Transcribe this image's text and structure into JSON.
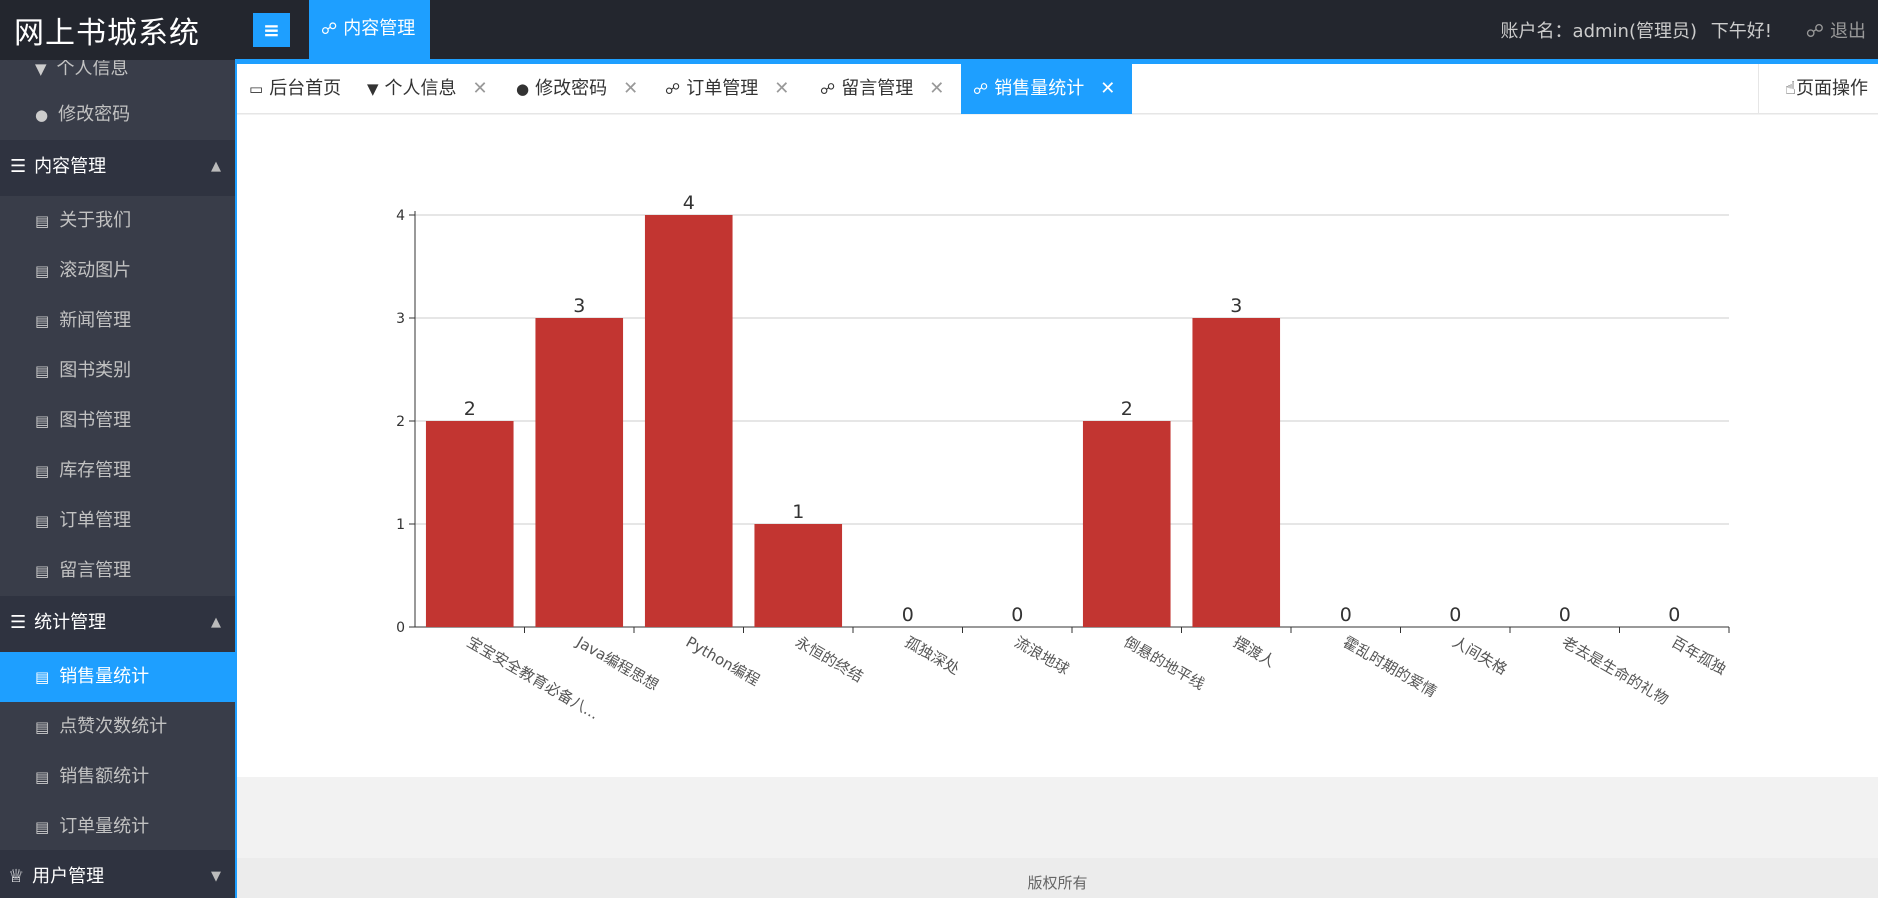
{
  "app": {
    "title": "网上书城系统",
    "menu_toggle_glyph": "≡",
    "top_tab": "内容管理",
    "user": "账户名：admin(管理员)",
    "greeting": "下午好!",
    "logout": "退出"
  },
  "sidebar": {
    "items_top": [
      "个人信息",
      "修改密码"
    ],
    "group_content": "内容管理",
    "content_items": [
      "关于我们",
      "滚动图片",
      "新闻管理",
      "图书类别",
      "图书管理",
      "库存管理",
      "订单管理",
      "留言管理"
    ],
    "group_stats": "统计管理",
    "stats_items": [
      "销售量统计",
      "点赞次数统计",
      "销售额统计",
      "订单量统计"
    ],
    "active_item": "销售量统计",
    "group_users": "用户管理"
  },
  "tabs": [
    {
      "label": "后台首页",
      "icon": "monitor-icon",
      "closable": false
    },
    {
      "label": "个人信息",
      "icon": "shirt-icon",
      "closable": true
    },
    {
      "label": "修改密码",
      "icon": "user-lock-icon",
      "closable": true
    },
    {
      "label": "订单管理",
      "icon": "hand-coins-icon",
      "closable": true
    },
    {
      "label": "留言管理",
      "icon": "hand-coins-icon",
      "closable": true
    },
    {
      "label": "销售量统计",
      "icon": "hand-coins-icon",
      "closable": true,
      "active": true
    }
  ],
  "page_ops": "页面操作",
  "footer": "版权所有",
  "colors": {
    "accent": "#1e9fff",
    "bar": "#c23531",
    "header_bg": "#23262e",
    "sidebar_bg": "#393d49"
  },
  "chart_data": {
    "type": "bar",
    "categories": [
      "宝宝安全教育必备八...",
      "Java编程思想",
      "Python编程",
      "永恒的终结",
      "孤独深处",
      "流浪地球",
      "倒悬的地平线",
      "摆渡人",
      "霍乱时期的爱情",
      "人间失格",
      "老去是生命的礼物",
      "百年孤独"
    ],
    "values": [
      2,
      3,
      4,
      1,
      0,
      0,
      2,
      3,
      0,
      0,
      0,
      0
    ],
    "ylim": [
      0,
      4
    ],
    "yticks": [
      0,
      1,
      2,
      3,
      4
    ],
    "grid": true,
    "data_labels": true
  }
}
